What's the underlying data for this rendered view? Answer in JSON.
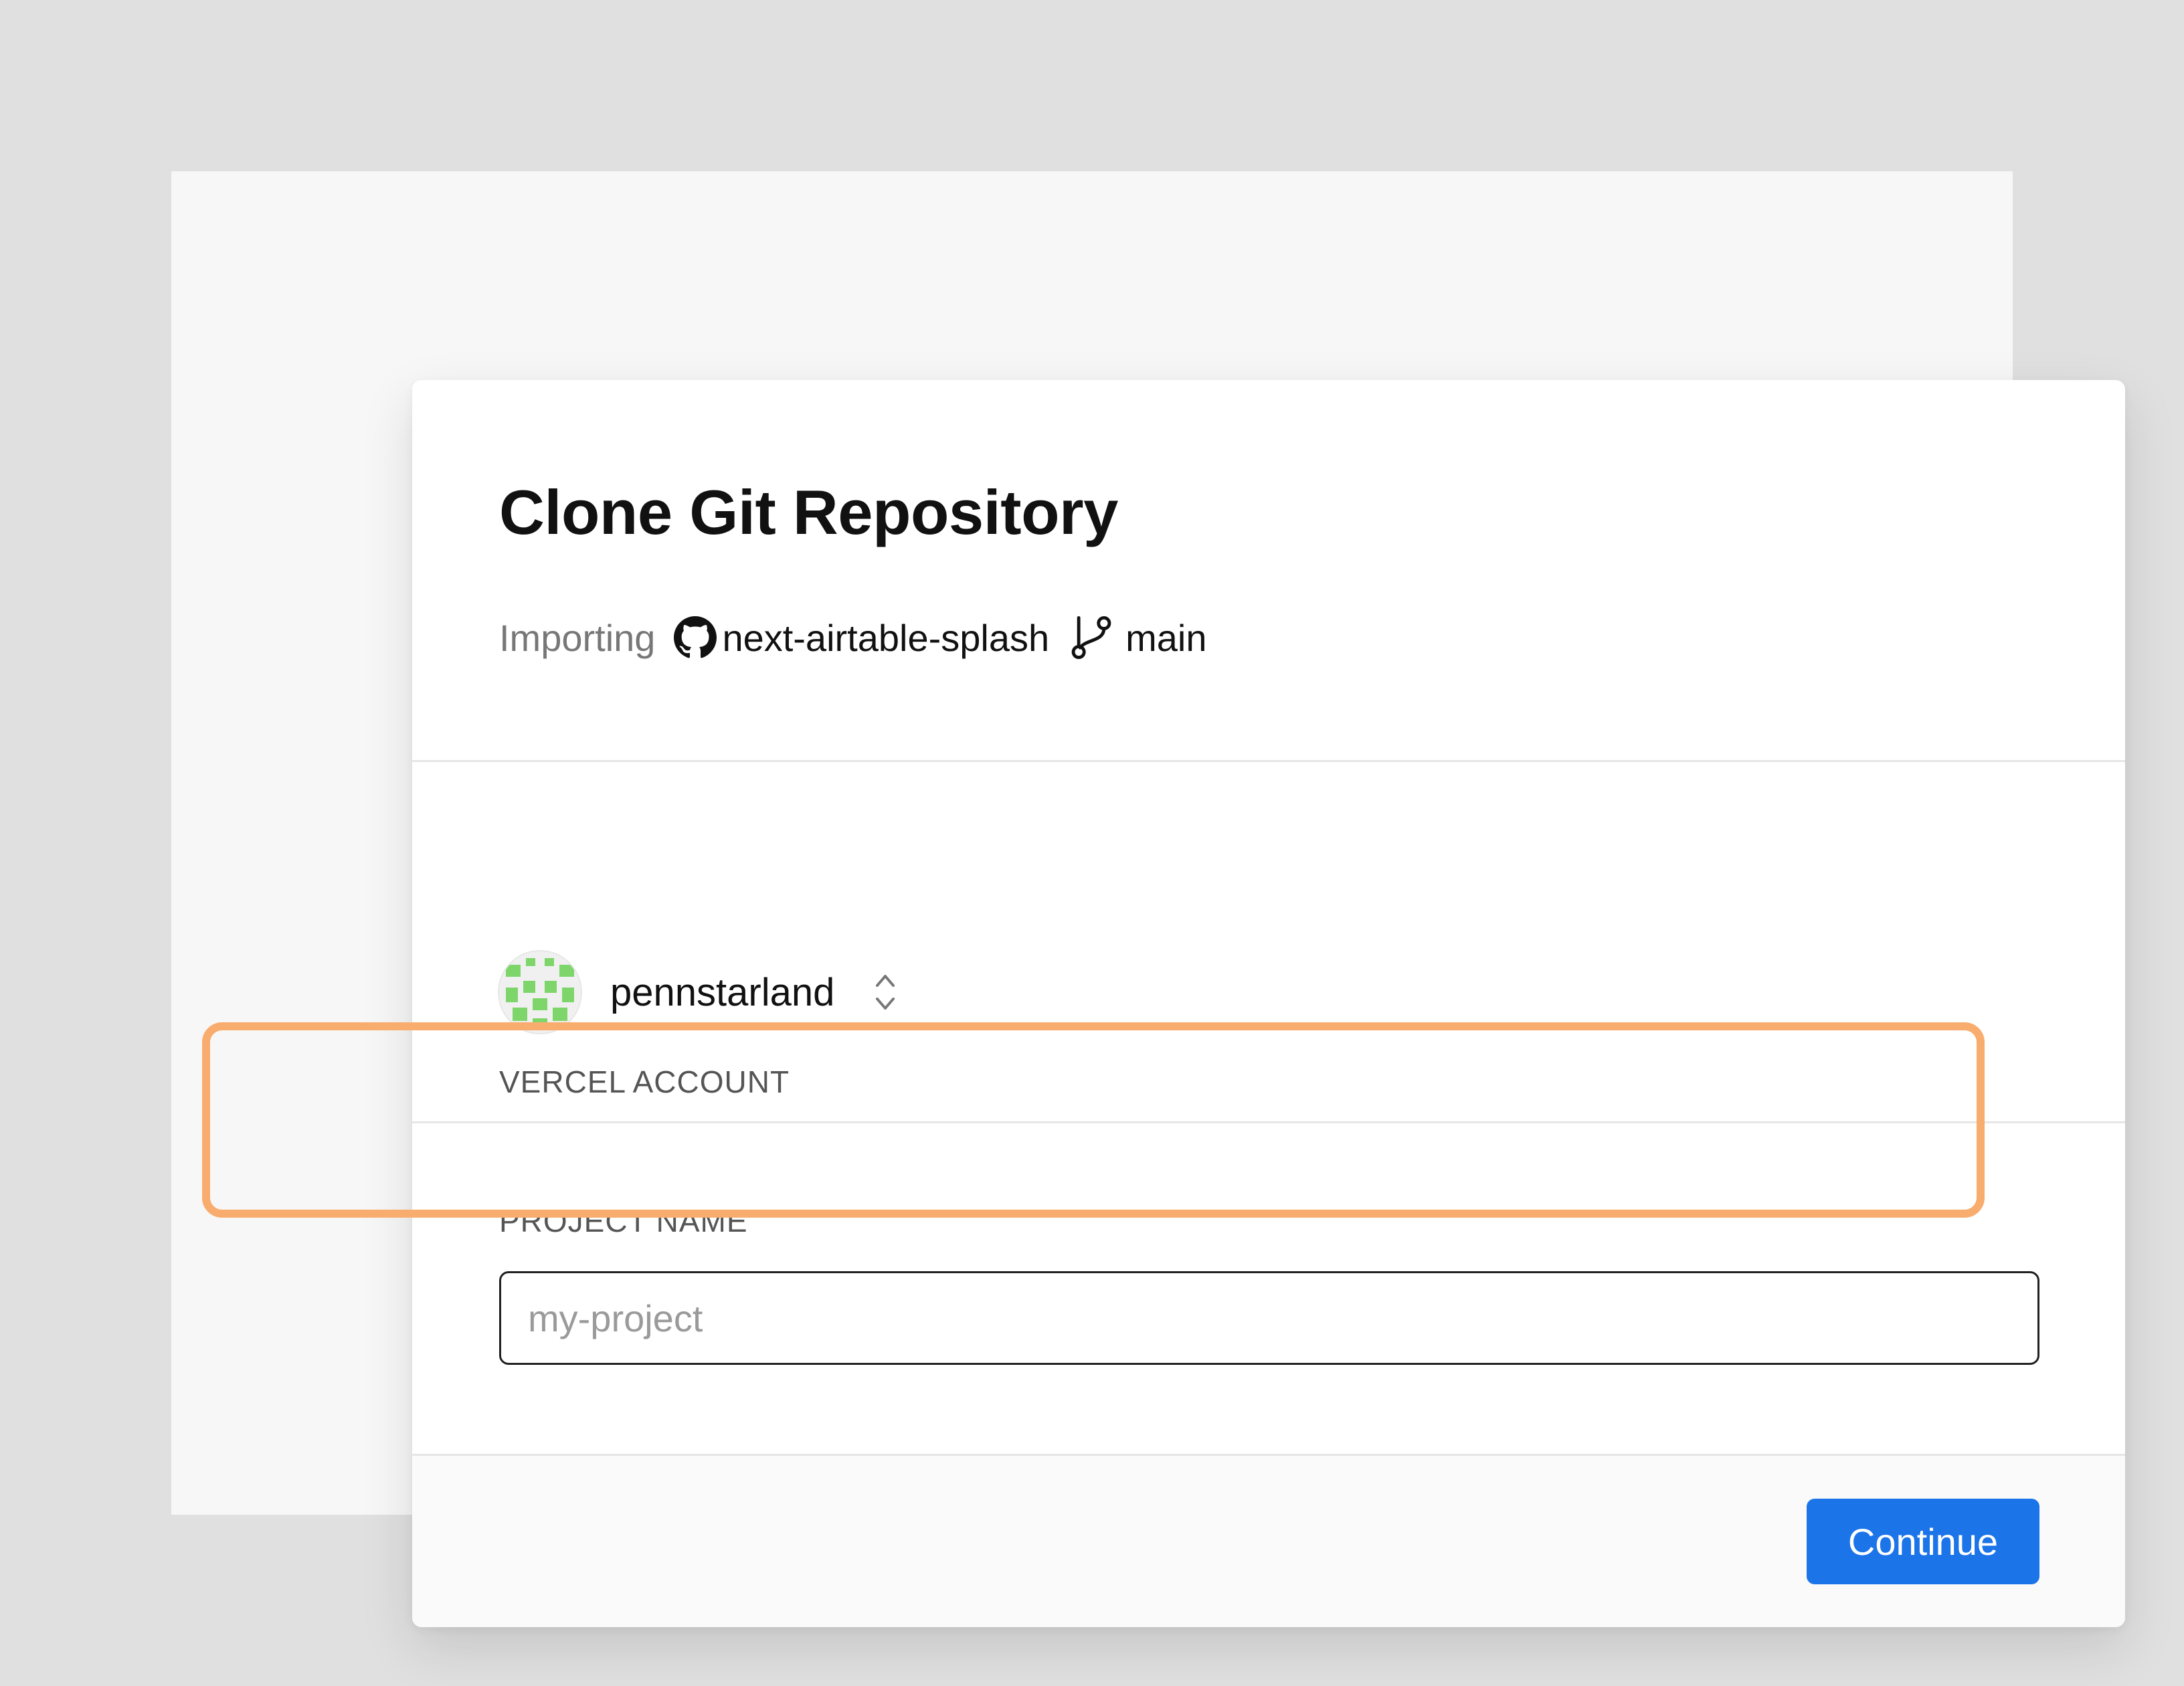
{
  "dialog": {
    "title": "Clone Git Repository",
    "importing_label": "Importing",
    "repo_name": "next-airtable-splash",
    "branch": "main"
  },
  "account": {
    "label": "VERCEL ACCOUNT",
    "name": "pennstarland"
  },
  "project": {
    "label": "PROJECT NAME",
    "placeholder": "my-project",
    "value": ""
  },
  "footer": {
    "continue_label": "Continue"
  },
  "colors": {
    "page_background": "#e0e0e0",
    "primary_button": "#1c74e9",
    "highlight_outline": "#f8ac6e",
    "avatar_pattern": "#7ed66b"
  },
  "icons": {
    "repo": "github-icon",
    "branch": "git-branch-icon",
    "account_switch": "chevron-up-down-icon"
  }
}
